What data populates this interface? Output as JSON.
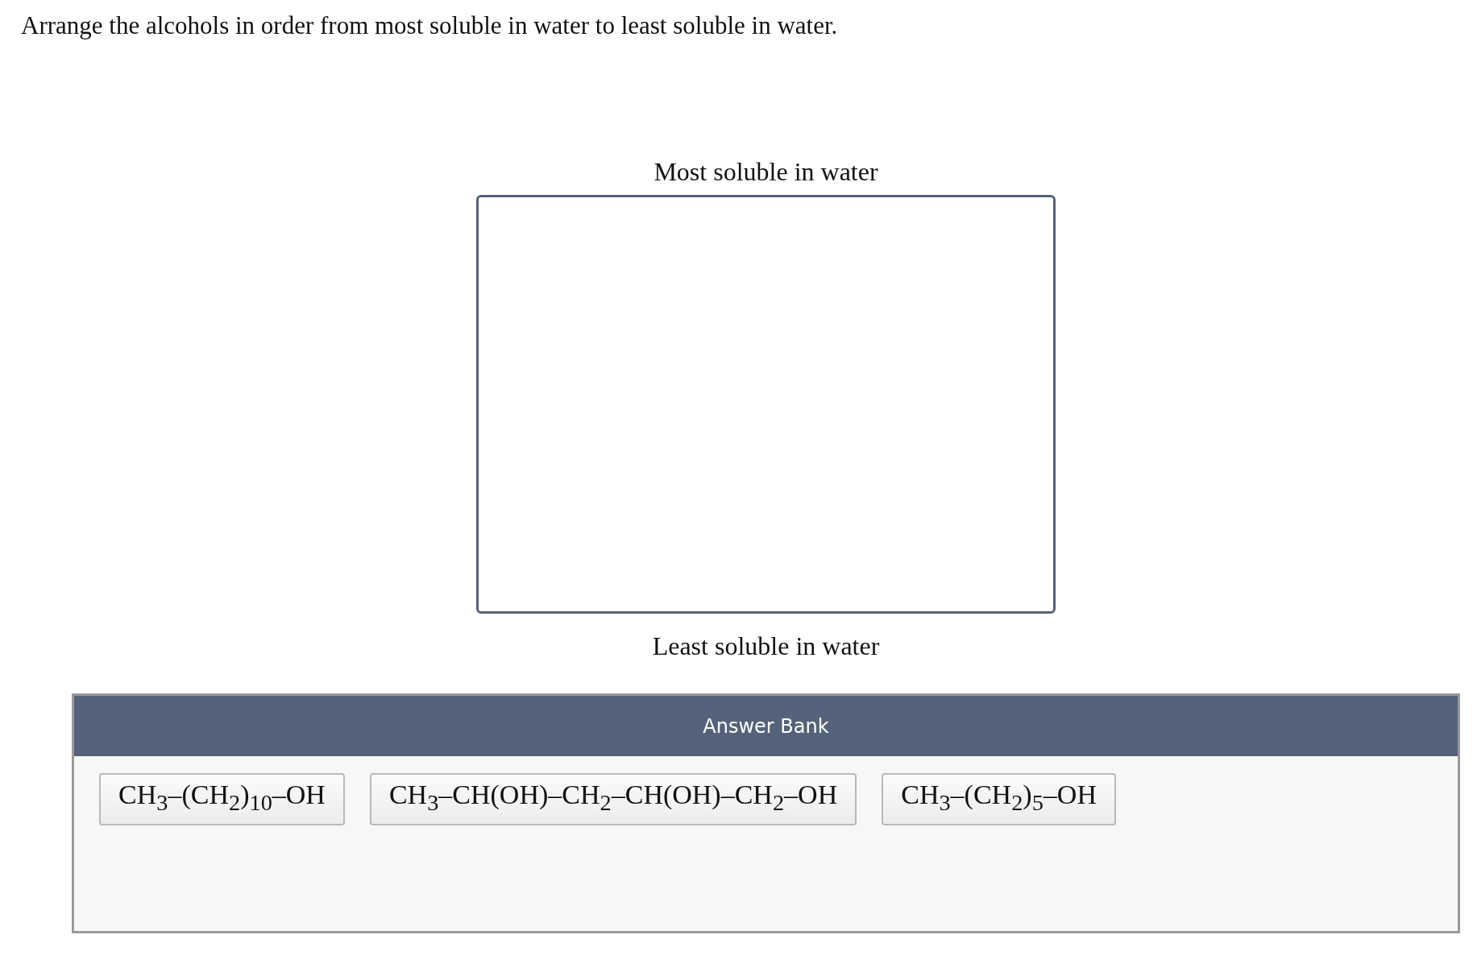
{
  "question": "Arrange the alcohols in order from most soluble in water to least soluble in water.",
  "ranking": {
    "top_label": "Most soluble in water",
    "bottom_label": "Least soluble in water"
  },
  "answer_bank": {
    "title": "Answer Bank",
    "items": [
      {
        "label": "CH$_{3}$–(CH$_{2}$)$_{10}$–OH"
      },
      {
        "label": "CH$_{3}$–CH(OH)–CH$_{2}$–CH(OH)–CH$_{2}$–OH"
      },
      {
        "label": "CH$_{3}$–(CH$_{2}$)$_{5}$–OH"
      }
    ]
  }
}
